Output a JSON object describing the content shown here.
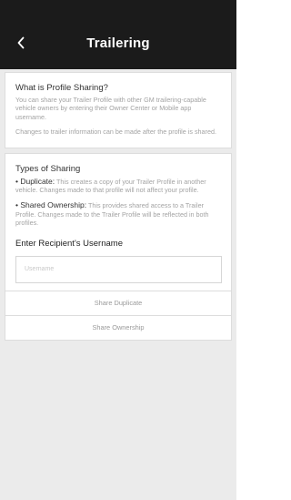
{
  "header": {
    "title": "Trailering",
    "back_icon": "chevron-left-icon"
  },
  "profile_sharing": {
    "heading": "What is Profile Sharing?",
    "description": "You can share your Trailer Profile with other GM trailering-capable vehicle owners by entering their Owner Center or Mobile app username.",
    "note": "Changes to trailer information can be made after the profile is shared."
  },
  "types": {
    "heading": "Types of Sharing",
    "duplicate": {
      "term": "• Duplicate:",
      "text": " This creates a copy of your Trailer Profile in another vehicle. Changes made to that profile will not affect your profile."
    },
    "shared_ownership": {
      "term": "• Shared Ownership:",
      "text": " This provides shared access to a Trailer Profile. Changes made to the Trailer Profile will be reflected in both profiles."
    },
    "recipient_label": "Enter Recipient's Username",
    "username_placeholder": "Username",
    "share_duplicate_label": "Share Duplicate",
    "share_ownership_label": "Share Ownership"
  }
}
